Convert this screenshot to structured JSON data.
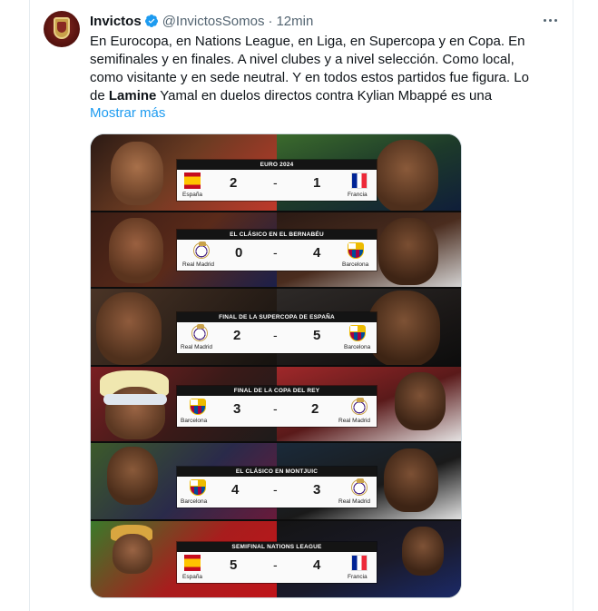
{
  "author": {
    "name": "Invictos",
    "handle": "@InvictosSomos",
    "separator": "·",
    "time": "12min"
  },
  "tweet": {
    "text_before_bold": "En Eurocopa, en Nations League, en Liga, en Supercopa y en Copa. En semifinales y en finales. A nivel clubes y a nivel selección. Como local, como visitante y en sede neutral. Y en todos estos partidos fue figura. Lo de ",
    "bold_word": "Lamine",
    "text_after_bold": " Yamal en duelos directos contra Kylian Mbappé es una",
    "show_more": "Mostrar más"
  },
  "icons": {
    "verified": "verified-badge-icon",
    "more": "more-options-icon"
  },
  "colors": {
    "link": "#1d9bf0",
    "verified": "#1d9bf0",
    "muted": "#536471",
    "text": "#0f1419"
  },
  "matches": [
    {
      "title": "EURO 2024",
      "home_team": "España",
      "home_score": "2",
      "separator": "-",
      "away_score": "1",
      "away_team": "Francia",
      "home_crest": "spain-flag-icon",
      "away_crest": "france-flag-icon"
    },
    {
      "title": "EL CLÁSICO EN EL BERNABÉU",
      "home_team": "Real Madrid",
      "home_score": "0",
      "separator": "-",
      "away_score": "4",
      "away_team": "Barcelona",
      "home_crest": "real-madrid-crest-icon",
      "away_crest": "barcelona-crest-icon"
    },
    {
      "title": "FINAL DE LA SUPERCOPA DE ESPAÑA",
      "home_team": "Real Madrid",
      "home_score": "2",
      "separator": "-",
      "away_score": "5",
      "away_team": "Barcelona",
      "home_crest": "real-madrid-crest-icon",
      "away_crest": "barcelona-crest-icon"
    },
    {
      "title": "FINAL DE LA COPA DEL REY",
      "home_team": "Barcelona",
      "home_score": "3",
      "separator": "-",
      "away_score": "2",
      "away_team": "Real Madrid",
      "home_crest": "barcelona-crest-icon",
      "away_crest": "real-madrid-crest-icon"
    },
    {
      "title": "EL CLÁSICO EN MONTJUIC",
      "home_team": "Barcelona",
      "home_score": "4",
      "separator": "-",
      "away_score": "3",
      "away_team": "Real Madrid",
      "home_crest": "barcelona-crest-icon",
      "away_crest": "real-madrid-crest-icon"
    },
    {
      "title": "SEMIFINAL NATIONS LEAGUE",
      "home_team": "España",
      "home_score": "5",
      "separator": "-",
      "away_score": "4",
      "away_team": "Francia",
      "home_crest": "spain-flag-icon",
      "away_crest": "france-flag-icon"
    }
  ]
}
